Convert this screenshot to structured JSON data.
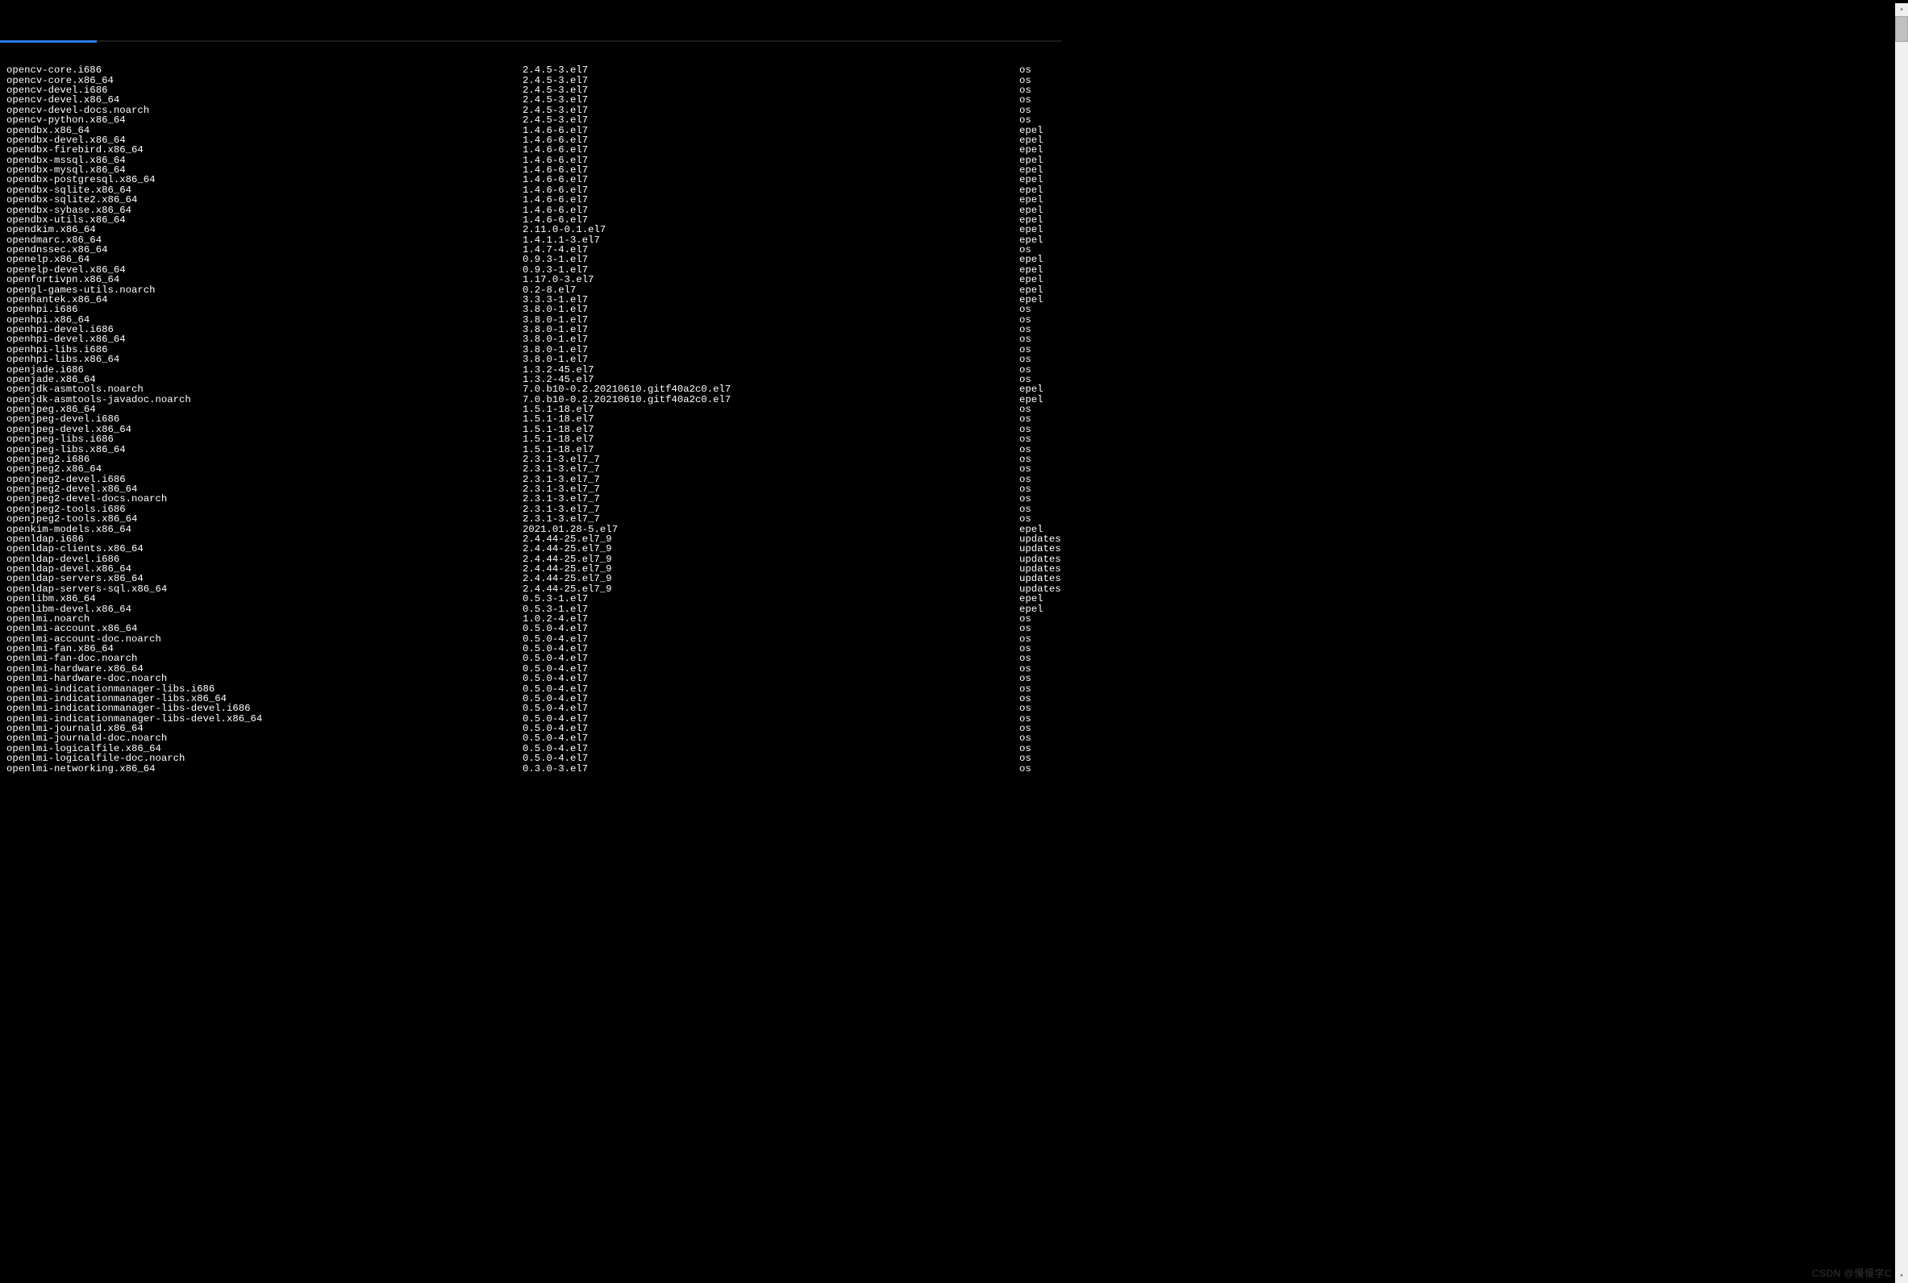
{
  "watermark": "CSDN @慢慢学C",
  "packages": [
    {
      "name": "opencv-core.i686",
      "version": "2.4.5-3.el7",
      "repo": "os"
    },
    {
      "name": "opencv-core.x86_64",
      "version": "2.4.5-3.el7",
      "repo": "os"
    },
    {
      "name": "opencv-devel.i686",
      "version": "2.4.5-3.el7",
      "repo": "os"
    },
    {
      "name": "opencv-devel.x86_64",
      "version": "2.4.5-3.el7",
      "repo": "os"
    },
    {
      "name": "opencv-devel-docs.noarch",
      "version": "2.4.5-3.el7",
      "repo": "os"
    },
    {
      "name": "opencv-python.x86_64",
      "version": "2.4.5-3.el7",
      "repo": "os"
    },
    {
      "name": "opendbx.x86_64",
      "version": "1.4.6-6.el7",
      "repo": "epel"
    },
    {
      "name": "opendbx-devel.x86_64",
      "version": "1.4.6-6.el7",
      "repo": "epel"
    },
    {
      "name": "opendbx-firebird.x86_64",
      "version": "1.4.6-6.el7",
      "repo": "epel"
    },
    {
      "name": "opendbx-mssql.x86_64",
      "version": "1.4.6-6.el7",
      "repo": "epel"
    },
    {
      "name": "opendbx-mysql.x86_64",
      "version": "1.4.6-6.el7",
      "repo": "epel"
    },
    {
      "name": "opendbx-postgresql.x86_64",
      "version": "1.4.6-6.el7",
      "repo": "epel"
    },
    {
      "name": "opendbx-sqlite.x86_64",
      "version": "1.4.6-6.el7",
      "repo": "epel"
    },
    {
      "name": "opendbx-sqlite2.x86_64",
      "version": "1.4.6-6.el7",
      "repo": "epel"
    },
    {
      "name": "opendbx-sybase.x86_64",
      "version": "1.4.6-6.el7",
      "repo": "epel"
    },
    {
      "name": "opendbx-utils.x86_64",
      "version": "1.4.6-6.el7",
      "repo": "epel"
    },
    {
      "name": "opendkim.x86_64",
      "version": "2.11.0-0.1.el7",
      "repo": "epel"
    },
    {
      "name": "opendmarc.x86_64",
      "version": "1.4.1.1-3.el7",
      "repo": "epel"
    },
    {
      "name": "opendnssec.x86_64",
      "version": "1.4.7-4.el7",
      "repo": "os"
    },
    {
      "name": "openelp.x86_64",
      "version": "0.9.3-1.el7",
      "repo": "epel"
    },
    {
      "name": "openelp-devel.x86_64",
      "version": "0.9.3-1.el7",
      "repo": "epel"
    },
    {
      "name": "openfortivpn.x86_64",
      "version": "1.17.0-3.el7",
      "repo": "epel"
    },
    {
      "name": "opengl-games-utils.noarch",
      "version": "0.2-8.el7",
      "repo": "epel"
    },
    {
      "name": "openhantek.x86_64",
      "version": "3.3.3-1.el7",
      "repo": "epel"
    },
    {
      "name": "openhpi.i686",
      "version": "3.8.0-1.el7",
      "repo": "os"
    },
    {
      "name": "openhpi.x86_64",
      "version": "3.8.0-1.el7",
      "repo": "os"
    },
    {
      "name": "openhpi-devel.i686",
      "version": "3.8.0-1.el7",
      "repo": "os"
    },
    {
      "name": "openhpi-devel.x86_64",
      "version": "3.8.0-1.el7",
      "repo": "os"
    },
    {
      "name": "openhpi-libs.i686",
      "version": "3.8.0-1.el7",
      "repo": "os"
    },
    {
      "name": "openhpi-libs.x86_64",
      "version": "3.8.0-1.el7",
      "repo": "os"
    },
    {
      "name": "openjade.i686",
      "version": "1.3.2-45.el7",
      "repo": "os"
    },
    {
      "name": "openjade.x86_64",
      "version": "1.3.2-45.el7",
      "repo": "os"
    },
    {
      "name": "openjdk-asmtools.noarch",
      "version": "7.0.b10-0.2.20210610.gitf40a2c0.el7",
      "repo": "epel"
    },
    {
      "name": "openjdk-asmtools-javadoc.noarch",
      "version": "7.0.b10-0.2.20210610.gitf40a2c0.el7",
      "repo": "epel"
    },
    {
      "name": "openjpeg.x86_64",
      "version": "1.5.1-18.el7",
      "repo": "os"
    },
    {
      "name": "openjpeg-devel.i686",
      "version": "1.5.1-18.el7",
      "repo": "os"
    },
    {
      "name": "openjpeg-devel.x86_64",
      "version": "1.5.1-18.el7",
      "repo": "os"
    },
    {
      "name": "openjpeg-libs.i686",
      "version": "1.5.1-18.el7",
      "repo": "os"
    },
    {
      "name": "openjpeg-libs.x86_64",
      "version": "1.5.1-18.el7",
      "repo": "os"
    },
    {
      "name": "openjpeg2.i686",
      "version": "2.3.1-3.el7_7",
      "repo": "os"
    },
    {
      "name": "openjpeg2.x86_64",
      "version": "2.3.1-3.el7_7",
      "repo": "os"
    },
    {
      "name": "openjpeg2-devel.i686",
      "version": "2.3.1-3.el7_7",
      "repo": "os"
    },
    {
      "name": "openjpeg2-devel.x86_64",
      "version": "2.3.1-3.el7_7",
      "repo": "os"
    },
    {
      "name": "openjpeg2-devel-docs.noarch",
      "version": "2.3.1-3.el7_7",
      "repo": "os"
    },
    {
      "name": "openjpeg2-tools.i686",
      "version": "2.3.1-3.el7_7",
      "repo": "os"
    },
    {
      "name": "openjpeg2-tools.x86_64",
      "version": "2.3.1-3.el7_7",
      "repo": "os"
    },
    {
      "name": "openkim-models.x86_64",
      "version": "2021.01.28-5.el7",
      "repo": "epel"
    },
    {
      "name": "openldap.i686",
      "version": "2.4.44-25.el7_9",
      "repo": "updates"
    },
    {
      "name": "openldap-clients.x86_64",
      "version": "2.4.44-25.el7_9",
      "repo": "updates"
    },
    {
      "name": "openldap-devel.i686",
      "version": "2.4.44-25.el7_9",
      "repo": "updates"
    },
    {
      "name": "openldap-devel.x86_64",
      "version": "2.4.44-25.el7_9",
      "repo": "updates"
    },
    {
      "name": "openldap-servers.x86_64",
      "version": "2.4.44-25.el7_9",
      "repo": "updates"
    },
    {
      "name": "openldap-servers-sql.x86_64",
      "version": "2.4.44-25.el7_9",
      "repo": "updates"
    },
    {
      "name": "openlibm.x86_64",
      "version": "0.5.3-1.el7",
      "repo": "epel"
    },
    {
      "name": "openlibm-devel.x86_64",
      "version": "0.5.3-1.el7",
      "repo": "epel"
    },
    {
      "name": "openlmi.noarch",
      "version": "1.0.2-4.el7",
      "repo": "os"
    },
    {
      "name": "openlmi-account.x86_64",
      "version": "0.5.0-4.el7",
      "repo": "os"
    },
    {
      "name": "openlmi-account-doc.noarch",
      "version": "0.5.0-4.el7",
      "repo": "os"
    },
    {
      "name": "openlmi-fan.x86_64",
      "version": "0.5.0-4.el7",
      "repo": "os"
    },
    {
      "name": "openlmi-fan-doc.noarch",
      "version": "0.5.0-4.el7",
      "repo": "os"
    },
    {
      "name": "openlmi-hardware.x86_64",
      "version": "0.5.0-4.el7",
      "repo": "os"
    },
    {
      "name": "openlmi-hardware-doc.noarch",
      "version": "0.5.0-4.el7",
      "repo": "os"
    },
    {
      "name": "openlmi-indicationmanager-libs.i686",
      "version": "0.5.0-4.el7",
      "repo": "os"
    },
    {
      "name": "openlmi-indicationmanager-libs.x86_64",
      "version": "0.5.0-4.el7",
      "repo": "os"
    },
    {
      "name": "openlmi-indicationmanager-libs-devel.i686",
      "version": "0.5.0-4.el7",
      "repo": "os"
    },
    {
      "name": "openlmi-indicationmanager-libs-devel.x86_64",
      "version": "0.5.0-4.el7",
      "repo": "os"
    },
    {
      "name": "openlmi-journald.x86_64",
      "version": "0.5.0-4.el7",
      "repo": "os"
    },
    {
      "name": "openlmi-journald-doc.noarch",
      "version": "0.5.0-4.el7",
      "repo": "os"
    },
    {
      "name": "openlmi-logicalfile.x86_64",
      "version": "0.5.0-4.el7",
      "repo": "os"
    },
    {
      "name": "openlmi-logicalfile-doc.noarch",
      "version": "0.5.0-4.el7",
      "repo": "os"
    },
    {
      "name": "openlmi-networking.x86_64",
      "version": "0.3.0-3.el7",
      "repo": "os"
    }
  ]
}
